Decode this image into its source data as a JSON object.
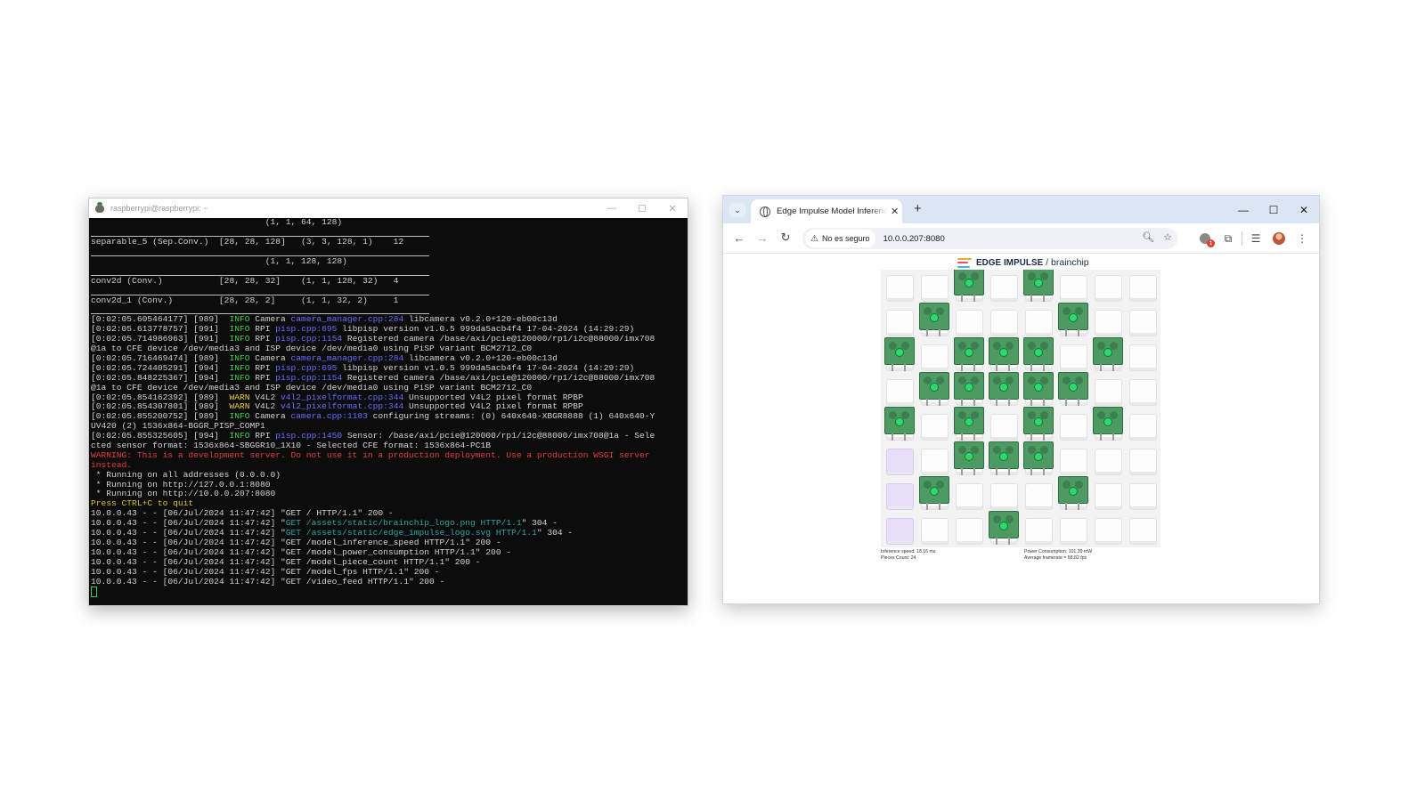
{
  "terminal": {
    "title": "raspberrypi@raspberrypi: ~",
    "controls": {
      "minimize": "—",
      "maximize": "☐",
      "close": "✕"
    },
    "table": [
      {
        "text": "                                  (1, 1, 64, 128)",
        "sep_after": true
      },
      {
        "text": "separable_5 (Sep.Conv.)  [28, 28, 128]   (3, 3, 128, 1)    12",
        "sep_after": true
      },
      {
        "text": "                                  (1, 1, 128, 128)",
        "sep_after": true
      },
      {
        "text": "conv2d (Conv.)           [28, 28, 32]    (1, 1, 128, 32)   4",
        "sep_after": true
      },
      {
        "text": "conv2d_1 (Conv.)         [28, 28, 2]     (1, 1, 32, 2)     1",
        "sep_after": true
      }
    ],
    "lines": [
      [
        {
          "t": "[0:02:05.605464177] [989]  "
        },
        {
          "t": "INFO",
          "c": "c-info"
        },
        {
          "t": " Camera "
        },
        {
          "t": "camera_manager.cpp:284",
          "c": "c-link"
        },
        {
          "t": " libcamera v0.2.0+120-eb00c13d"
        }
      ],
      [
        {
          "t": "[0:02:05.613778757] [991]  "
        },
        {
          "t": "INFO",
          "c": "c-info"
        },
        {
          "t": " RPI "
        },
        {
          "t": "pisp.cpp:695",
          "c": "c-link"
        },
        {
          "t": " libpisp version v1.0.5 999da5acb4f4 17-04-2024 (14:29:29)"
        }
      ],
      [
        {
          "t": "[0:02:05.714986963] [991]  "
        },
        {
          "t": "INFO",
          "c": "c-info"
        },
        {
          "t": " RPI "
        },
        {
          "t": "pisp.cpp:1154",
          "c": "c-link"
        },
        {
          "t": " Registered camera /base/axi/pcie@120000/rp1/i2c@88000/imx708"
        }
      ],
      [
        {
          "t": "@1a to CFE device /dev/media3 and ISP device /dev/media0 using PiSP variant BCM2712_C0"
        }
      ],
      [
        {
          "t": "[0:02:05.716469474] [989]  "
        },
        {
          "t": "INFO",
          "c": "c-info"
        },
        {
          "t": " Camera "
        },
        {
          "t": "camera_manager.cpp:284",
          "c": "c-link"
        },
        {
          "t": " libcamera v0.2.0+120-eb00c13d"
        }
      ],
      [
        {
          "t": "[0:02:05.724405291] [994]  "
        },
        {
          "t": "INFO",
          "c": "c-info"
        },
        {
          "t": " RPI "
        },
        {
          "t": "pisp.cpp:695",
          "c": "c-link"
        },
        {
          "t": " libpisp version v1.0.5 999da5acb4f4 17-04-2024 (14:29:29)"
        }
      ],
      [
        {
          "t": "[0:02:05.848225367] [994]  "
        },
        {
          "t": "INFO",
          "c": "c-info"
        },
        {
          "t": " RPI "
        },
        {
          "t": "pisp.cpp:1154",
          "c": "c-link"
        },
        {
          "t": " Registered camera /base/axi/pcie@120000/rp1/i2c@88000/imx708"
        }
      ],
      [
        {
          "t": "@1a to CFE device /dev/media3 and ISP device /dev/media0 using PiSP variant BCM2712_C0"
        }
      ],
      [
        {
          "t": "[0:02:05.854162392] [989]  "
        },
        {
          "t": "WARN",
          "c": "c-warn"
        },
        {
          "t": " V4L2 "
        },
        {
          "t": "v4l2_pixelformat.cpp:344",
          "c": "c-link"
        },
        {
          "t": " Unsupported V4L2 pixel format RPBP"
        }
      ],
      [
        {
          "t": "[0:02:05.854307801] [989]  "
        },
        {
          "t": "WARN",
          "c": "c-warn"
        },
        {
          "t": " V4L2 "
        },
        {
          "t": "v4l2_pixelformat.cpp:344",
          "c": "c-link"
        },
        {
          "t": " Unsupported V4L2 pixel format RPBP"
        }
      ],
      [
        {
          "t": "[0:02:05.855200752] [989]  "
        },
        {
          "t": "INFO",
          "c": "c-info"
        },
        {
          "t": " Camera "
        },
        {
          "t": "camera.cpp:1183",
          "c": "c-link"
        },
        {
          "t": " configuring streams: (0) 640x640-XBGR8888 (1) 640x640-Y"
        }
      ],
      [
        {
          "t": "UV420 (2) 1536x864-BGGR_PISP_COMP1"
        }
      ],
      [
        {
          "t": "[0:02:05.855325605] [994]  "
        },
        {
          "t": "INFO",
          "c": "c-info"
        },
        {
          "t": " RPI "
        },
        {
          "t": "pisp.cpp:1450",
          "c": "c-link"
        },
        {
          "t": " Sensor: /base/axi/pcie@120000/rp1/i2c@88000/imx708@1a - Sele"
        }
      ],
      [
        {
          "t": "cted sensor format: 1536x864-SBGGR10_1X10 - Selected CFE format: 1536x864-PC1B"
        }
      ],
      [
        {
          "t": "WARNING: This is a development server. Do not use it in a production deployment. Use a production WSGI server",
          "c": "c-red"
        }
      ],
      [
        {
          "t": "instead.",
          "c": "c-red"
        }
      ],
      [
        {
          "t": " * Running on all addresses (0.0.0.0)"
        }
      ],
      [
        {
          "t": " * Running on http://127.0.0.1:8080"
        }
      ],
      [
        {
          "t": " * Running on http://10.0.0.207:8080"
        }
      ],
      [
        {
          "t": "Press CTRL+C to quit",
          "c": "c-ylw"
        }
      ],
      [
        {
          "t": "10.0.0.43 - - [06/Jul/2024 11:47:42] \"GET / HTTP/1.1\" 200 -"
        }
      ],
      [
        {
          "t": "10.0.0.43 - - [06/Jul/2024 11:47:42] \""
        },
        {
          "t": "GET /assets/static/brainchip_logo.png HTTP/1.1",
          "c": "c-teal"
        },
        {
          "t": "\" 304 -"
        }
      ],
      [
        {
          "t": "10.0.0.43 - - [06/Jul/2024 11:47:42] \""
        },
        {
          "t": "GET /assets/static/edge_impulse_logo.svg HTTP/1.1",
          "c": "c-teal"
        },
        {
          "t": "\" 304 -"
        }
      ],
      [
        {
          "t": "10.0.0.43 - - [06/Jul/2024 11:47:42] \"GET /model_inference_speed HTTP/1.1\" 200 -"
        }
      ],
      [
        {
          "t": "10.0.0.43 - - [06/Jul/2024 11:47:42] \"GET /model_power_consumption HTTP/1.1\" 200 -"
        }
      ],
      [
        {
          "t": "10.0.0.43 - - [06/Jul/2024 11:47:42] \"GET /model_piece_count HTTP/1.1\" 200 -"
        }
      ],
      [
        {
          "t": "10.0.0.43 - - [06/Jul/2024 11:47:42] \"GET /model_fps HTTP/1.1\" 200 -"
        }
      ],
      [
        {
          "t": "10.0.0.43 - - [06/Jul/2024 11:47:42] \"GET /video_feed HTTP/1.1\" 200 -"
        }
      ]
    ]
  },
  "browser": {
    "tab_title": "Edge Impulse Model Inferencing",
    "tab_close": "✕",
    "new_tab": "+",
    "window_controls": {
      "minimize": "—",
      "maximize": "☐",
      "close": "✕"
    },
    "nav": {
      "back": "←",
      "forward": "→",
      "reload": "↻"
    },
    "security_chip": "No es seguro",
    "url": "10.0.0.207:8080",
    "extension_badge": "1",
    "page": {
      "brand_edge": "EDGE IMPULSE",
      "brand_sep": "/",
      "brand_partner": "brainchip",
      "logo_colors": [
        "#f5a623",
        "#e94e77",
        "#3fb3e6"
      ],
      "inference_speed": "Inference speed: 18.16 ms",
      "pieces_count": "Pieces Count: 24",
      "power": "Power Consumption: 101.39 mW",
      "framerate": "Average framerate = 58.82 fps"
    }
  }
}
